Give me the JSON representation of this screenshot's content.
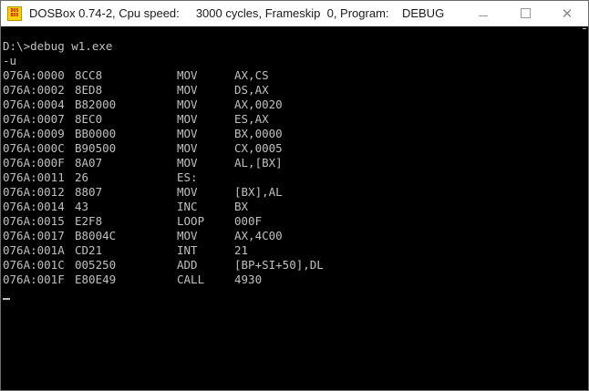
{
  "window": {
    "title": "DOSBox 0.74-2, Cpu speed:     3000 cycles, Frameskip  0, Program:    DEBUG",
    "icon_label_top": "DOS",
    "icon_label_bottom": "BOX",
    "minimize_label": "",
    "maximize_label": "",
    "close_label": "✕"
  },
  "console": {
    "command_line": "D:\\>debug w1.exe",
    "debug_command": "-u",
    "disassembly": [
      {
        "addr": "076A:0000",
        "bytes": "8CC8",
        "mnem": "MOV",
        "ops": "AX,CS"
      },
      {
        "addr": "076A:0002",
        "bytes": "8ED8",
        "mnem": "MOV",
        "ops": "DS,AX"
      },
      {
        "addr": "076A:0004",
        "bytes": "B82000",
        "mnem": "MOV",
        "ops": "AX,0020"
      },
      {
        "addr": "076A:0007",
        "bytes": "8EC0",
        "mnem": "MOV",
        "ops": "ES,AX"
      },
      {
        "addr": "076A:0009",
        "bytes": "BB0000",
        "mnem": "MOV",
        "ops": "BX,0000"
      },
      {
        "addr": "076A:000C",
        "bytes": "B90500",
        "mnem": "MOV",
        "ops": "CX,0005"
      },
      {
        "addr": "076A:000F",
        "bytes": "8A07",
        "mnem": "MOV",
        "ops": "AL,[BX]"
      },
      {
        "addr": "076A:0011",
        "bytes": "26",
        "mnem": "ES:",
        "ops": ""
      },
      {
        "addr": "076A:0012",
        "bytes": "8807",
        "mnem": "MOV",
        "ops": "[BX],AL"
      },
      {
        "addr": "076A:0014",
        "bytes": "43",
        "mnem": "INC",
        "ops": "BX"
      },
      {
        "addr": "076A:0015",
        "bytes": "E2F8",
        "mnem": "LOOP",
        "ops": "000F"
      },
      {
        "addr": "076A:0017",
        "bytes": "B8004C",
        "mnem": "MOV",
        "ops": "AX,4C00"
      },
      {
        "addr": "076A:001A",
        "bytes": "CD21",
        "mnem": "INT",
        "ops": "21"
      },
      {
        "addr": "076A:001C",
        "bytes": "005250",
        "mnem": "ADD",
        "ops": "[BP+SI+50],DL"
      },
      {
        "addr": "076A:001F",
        "bytes": "E80E49",
        "mnem": "CALL",
        "ops": "4930"
      }
    ],
    "prompt": "-"
  }
}
